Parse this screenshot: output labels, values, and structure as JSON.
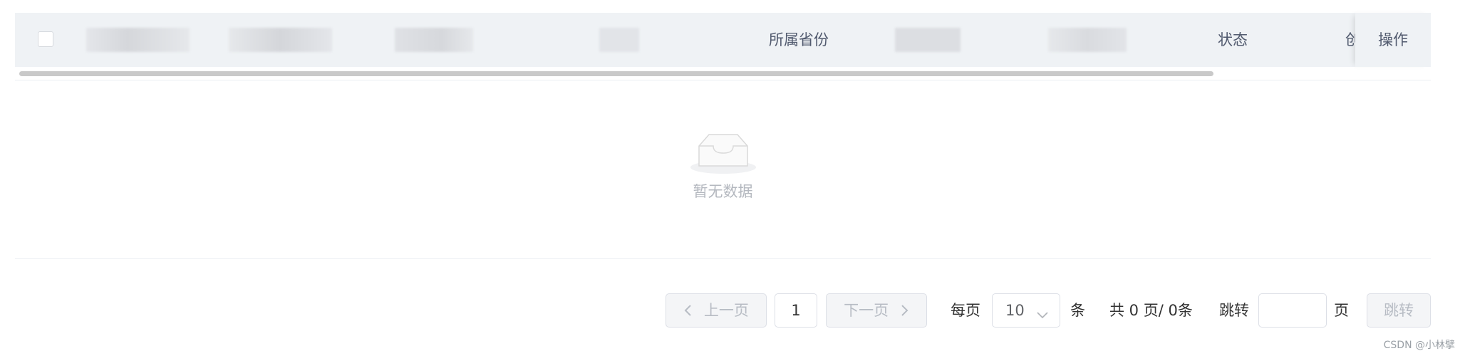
{
  "table": {
    "columns": [
      {
        "label": ""
      },
      {
        "label": ""
      },
      {
        "label": ""
      },
      {
        "label": ""
      },
      {
        "label": "所属省份"
      },
      {
        "label": ""
      },
      {
        "label": ""
      },
      {
        "label": "状态"
      },
      {
        "label": "创"
      }
    ],
    "fixed_column_label": "操作",
    "empty_text": "暂无数据"
  },
  "pagination": {
    "prev_label": "上一页",
    "current_page": "1",
    "next_label": "下一页",
    "per_page_label": "每页",
    "page_size": "10",
    "unit_label": "条",
    "total_text": "共 0 页/ 0条",
    "jump_label": "跳转",
    "jump_value": "",
    "page_unit": "页",
    "jump_button": "跳转"
  },
  "watermark": "CSDN @小林擘",
  "icons": {
    "prev": "chevron-left-icon",
    "next": "chevron-right-icon",
    "select": "chevron-down-icon",
    "empty": "empty-inbox-icon"
  }
}
